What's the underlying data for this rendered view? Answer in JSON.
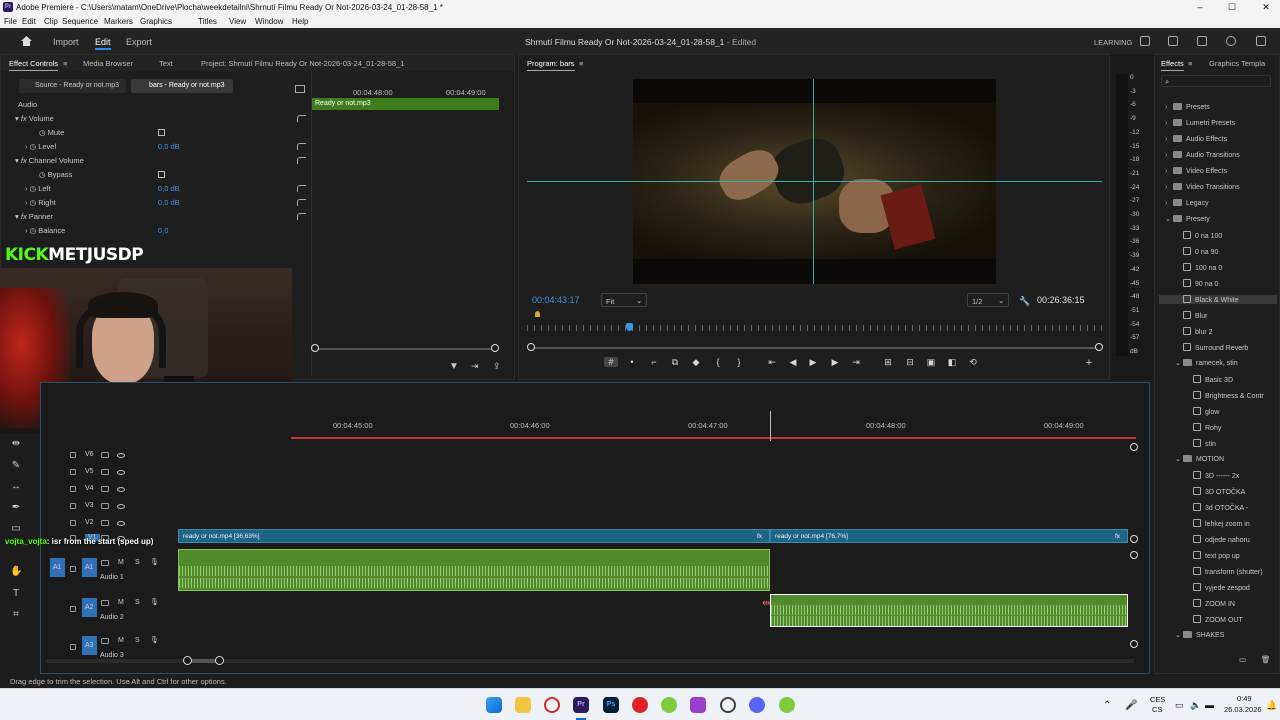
{
  "app": {
    "window_title": "Adobe Premiere - C:\\Users\\matam\\OneDrive\\Plocha\\weekdetailni\\Shrnutí Filmu Ready Or Not-2026-03-24_01-28-58_1 *",
    "icon_text": "Pr",
    "window_controls": [
      "–",
      "☐",
      "✕"
    ]
  },
  "menu": [
    "File",
    "Edit",
    "Clip",
    "Sequence",
    "Markers",
    "Graphics",
    "Titles",
    "View",
    "Window",
    "Help"
  ],
  "header": {
    "home_icon": "home-icon",
    "nav": [
      "Import",
      "Edit",
      "Export"
    ],
    "active_nav": "Edit",
    "document_title": "Shrnutí Filmu Ready Or Not-2026-03-24_01-28-58_1",
    "document_status": "- Edited",
    "workspace": "LEARNING"
  },
  "effect_controls": {
    "tabs": [
      "Effect Controls",
      "Media Browser",
      "Text",
      "Project: Shrnutí Filmu Ready Or Not-2026-03-24_01-28-58_1"
    ],
    "source_tabs": [
      "Source - Ready or not.mp3",
      "bars - Ready or not.mp3"
    ],
    "section": "Audio",
    "rows": [
      {
        "label": "Volume",
        "type": "fx"
      },
      {
        "label": "Mute",
        "type": "checkbox"
      },
      {
        "label": "Level",
        "value": "0,0 dB"
      },
      {
        "label": "Channel Volume",
        "type": "fx"
      },
      {
        "label": "Bypass",
        "type": "checkbox"
      },
      {
        "label": "Left",
        "value": "0,0 dB"
      },
      {
        "label": "Right",
        "value": "0,0 dB"
      },
      {
        "label": "Panner",
        "type": "fx"
      },
      {
        "label": "Balance",
        "value": "0,0"
      }
    ],
    "mini_timeline": {
      "times": [
        "00:04:48:00",
        "00:04:49:00"
      ],
      "clip": "Ready or not.mp3"
    }
  },
  "overlay": {
    "kick_prefix": "KICK",
    "kick_name": "METJUSDP",
    "chat_user": "vojta_vojta",
    "chat_message": ": isr from the start (sped up)"
  },
  "program": {
    "title": "Program: bars",
    "timecode": "00:04:43:17",
    "fit": "Fit",
    "resolution": "1/2",
    "duration": "00:26:36:15",
    "meter_scale": [
      "0",
      "-3",
      "-6",
      "-9",
      "-12",
      "-15",
      "-18",
      "-21",
      "-24",
      "-27",
      "-30",
      "-33",
      "-36",
      "-39",
      "-42",
      "-45",
      "-48",
      "-51",
      "-54",
      "-57",
      "dB"
    ]
  },
  "timeline": {
    "times": [
      "00:04:45:00",
      "00:04:46:00",
      "00:04:47:00",
      "00:04:48:00",
      "00:04:49:00"
    ],
    "video_tracks": [
      "V6",
      "V5",
      "V4",
      "V3",
      "V2",
      "V1"
    ],
    "audio_tracks": [
      {
        "id": "A1",
        "name": "Audio 1"
      },
      {
        "id": "A2",
        "name": "Audio 2"
      },
      {
        "id": "A3",
        "name": "Audio 3"
      }
    ],
    "video_clips": [
      "ready or not.mp4 [36,63%]",
      "ready or not.mp4 [76,7%]"
    ],
    "track_buttons": {
      "mute": "M",
      "solo": "S"
    }
  },
  "effects": {
    "tabs": [
      "Effects",
      "Graphics Templa"
    ],
    "tree": [
      {
        "label": "Presets",
        "type": "folder",
        "level": 0
      },
      {
        "label": "Lumetri Presets",
        "type": "folder",
        "level": 0
      },
      {
        "label": "Audio Effects",
        "type": "folder",
        "level": 0
      },
      {
        "label": "Audio Transitions",
        "type": "folder",
        "level": 0
      },
      {
        "label": "Video Effects",
        "type": "folder",
        "level": 0
      },
      {
        "label": "Video Transitions",
        "type": "folder",
        "level": 0
      },
      {
        "label": "Legacy",
        "type": "folder",
        "level": 0
      },
      {
        "label": "Presety",
        "type": "folder",
        "level": 0,
        "open": true
      },
      {
        "label": "0 na 100",
        "type": "fx",
        "level": 1
      },
      {
        "label": "0 na 90",
        "type": "fx",
        "level": 1
      },
      {
        "label": "100 na 0",
        "type": "fx",
        "level": 1
      },
      {
        "label": "90 na 0",
        "type": "fx",
        "level": 1
      },
      {
        "label": "Black & White",
        "type": "fx",
        "level": 1,
        "selected": true
      },
      {
        "label": "Blur",
        "type": "fx",
        "level": 1
      },
      {
        "label": "blur 2",
        "type": "fx",
        "level": 1
      },
      {
        "label": "Surround Reverb",
        "type": "fx",
        "level": 1
      },
      {
        "label": "ramecek, stin",
        "type": "folder",
        "level": 1,
        "open": true
      },
      {
        "label": "Basic 3D",
        "type": "fx",
        "level": 2
      },
      {
        "label": "Brightness & Contr",
        "type": "fx",
        "level": 2
      },
      {
        "label": "glow",
        "type": "fx",
        "level": 2
      },
      {
        "label": "Rohy",
        "type": "fx",
        "level": 2
      },
      {
        "label": "stin",
        "type": "fx",
        "level": 2
      },
      {
        "label": "MOTION",
        "type": "folder",
        "level": 1,
        "open": true
      },
      {
        "label": "3D ------ 2x",
        "type": "fx",
        "level": 2
      },
      {
        "label": "3D OTOČKA",
        "type": "fx",
        "level": 2
      },
      {
        "label": "3d OTOČKA -",
        "type": "fx",
        "level": 2
      },
      {
        "label": "lehkej zoom in",
        "type": "fx",
        "level": 2
      },
      {
        "label": "odjede nahoru",
        "type": "fx",
        "level": 2
      },
      {
        "label": "text pop up",
        "type": "fx",
        "level": 2
      },
      {
        "label": "transform (shutter)",
        "type": "fx",
        "level": 2
      },
      {
        "label": "vyjede zespod",
        "type": "fx",
        "level": 2
      },
      {
        "label": "ZOOM IN",
        "type": "fx",
        "level": 2
      },
      {
        "label": "ZOOM OUT",
        "type": "fx",
        "level": 2
      },
      {
        "label": "SHAKES",
        "type": "folder",
        "level": 1,
        "open": true
      }
    ]
  },
  "status_bar": "Drag edge to trim the selection. Use Alt and Ctrl for other options.",
  "taskbar": {
    "lang_top": "CES",
    "lang_bottom": "CS",
    "time": "0:49",
    "date": "26.03.2026"
  }
}
